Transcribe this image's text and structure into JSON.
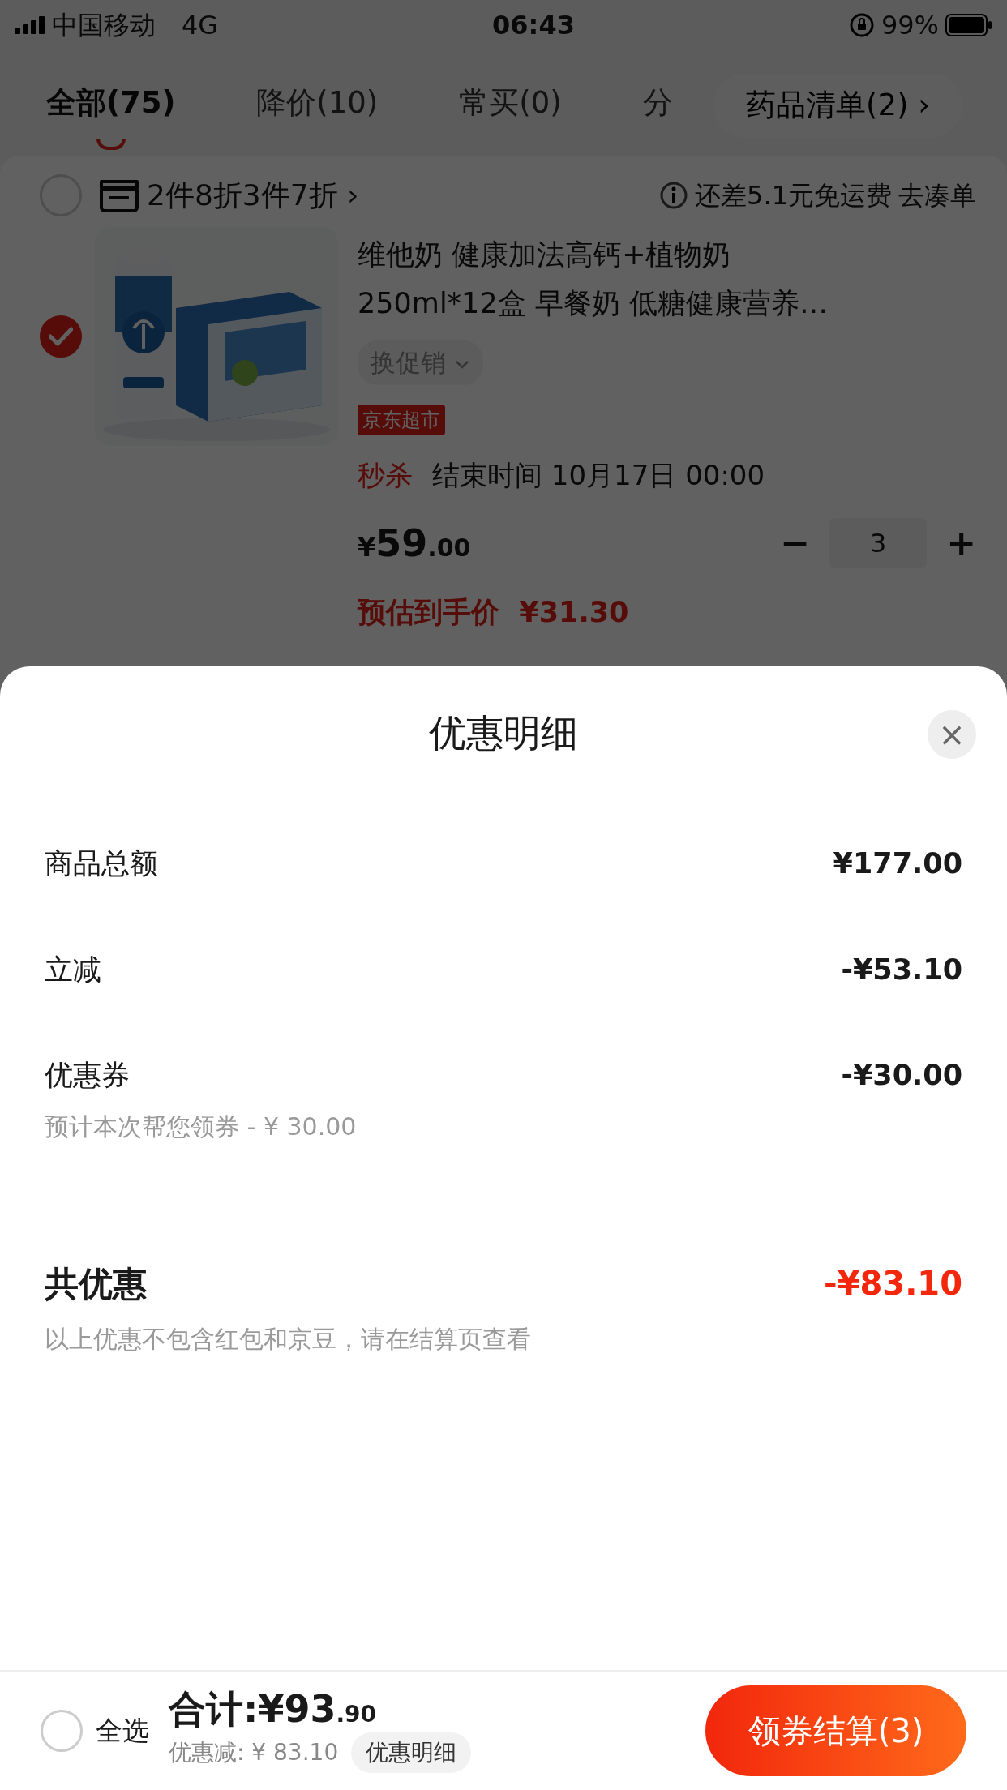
{
  "status_bar": {
    "carrier": "中国移动",
    "network": "4G",
    "time": "06:43",
    "battery": "99%"
  },
  "tabs": [
    {
      "label": "全部(75)",
      "selected": true
    },
    {
      "label": "降价(10)",
      "selected": false
    },
    {
      "label": "常买(0)",
      "selected": false
    },
    {
      "label": "分",
      "selected": false
    }
  ],
  "list_button": {
    "label": "药品清单(2)",
    "chevron": "›"
  },
  "store_row": {
    "checked": false,
    "promo": "2件8折3件7折",
    "chevron": "›",
    "shipping_note": "还差5.1元免运费",
    "shipping_link": "去凑单"
  },
  "product": {
    "checked": true,
    "title_lines": [
      "维他奶 健康加法高钙+植物奶",
      "250ml*12盒 早餐奶 低糖健康营养…"
    ],
    "promo_select": "换促销",
    "tag": "京东超市",
    "flash_label": "秒杀",
    "flash_end": "结束时间 10月17日 00:00",
    "currency": "¥",
    "price_int": "59",
    "price_dec": ".00",
    "minus": "−",
    "quantity": "3",
    "plus": "+",
    "estimate_label": "预估到手价",
    "estimate": "¥31.30"
  },
  "sheet": {
    "title": "优惠明细",
    "close": "×",
    "rows": [
      {
        "kind": "normal",
        "label": "商品总额",
        "value": "¥177.00"
      },
      {
        "kind": "normal",
        "label": "立减",
        "value": "-¥53.10"
      },
      {
        "kind": "normal",
        "label": "优惠券",
        "value": "-¥30.00",
        "note": "预计本次帮您领券 - ¥ 30.00"
      },
      {
        "kind": "total",
        "label": "共优惠",
        "value": "-¥83.10",
        "note": "以上优惠不包含红包和京豆，请在结算页查看"
      }
    ]
  },
  "bottom_bar": {
    "select_all_checked": false,
    "select_all": "全选",
    "total_label": "合计:",
    "total_int": "¥93",
    "total_dec": ".90",
    "discount": "优惠减: ¥ 83.10",
    "detail_button": "优惠明细",
    "checkout": "领券结算(3)"
  }
}
